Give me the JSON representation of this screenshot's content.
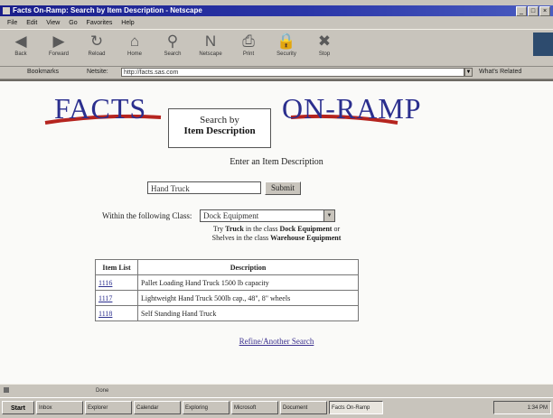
{
  "window": {
    "title": "Facts On-Ramp: Search by Item Description - Netscape"
  },
  "menu": [
    "File",
    "Edit",
    "View",
    "Go",
    "Favorites",
    "Help"
  ],
  "toolbar": [
    {
      "label": "Back",
      "icon": "back-arrow-icon"
    },
    {
      "label": "Forward",
      "icon": "forward-arrow-icon"
    },
    {
      "label": "Reload",
      "icon": "reload-icon"
    },
    {
      "label": "Home",
      "icon": "home-icon"
    },
    {
      "label": "Search",
      "icon": "search-icon"
    },
    {
      "label": "Netscape",
      "icon": "netscape-icon"
    },
    {
      "label": "Print",
      "icon": "print-icon"
    },
    {
      "label": "Security",
      "icon": "lock-icon"
    },
    {
      "label": "Stop",
      "icon": "stop-icon"
    }
  ],
  "address": {
    "bookmarks_label": "Bookmarks",
    "location_label": "Netsite:",
    "url": "http://facts.sas.com",
    "related_label": "What's Related"
  },
  "page": {
    "brand_left": "FACTS",
    "brand_right": "ON-RAMP",
    "box_line1": "Search by",
    "box_line2": "Item Description",
    "instruction": "Enter an Item Description",
    "search_value": "Hand Truck",
    "submit_label": "Submit",
    "class_label": "Within the following Class:",
    "class_value": "Dock Equipment",
    "hint1_pre": "Try",
    "hint1_bold1": "Truck",
    "hint1_mid": "in the class",
    "hint1_bold2": "Dock Equipment",
    "hint1_post": "or",
    "hint2_pre": "Shelves in the class",
    "hint2_bold": "Warehouse Equipment",
    "table_headers": [
      "Item List",
      "Description"
    ],
    "rows": [
      {
        "code": "1116",
        "description": "Pallet Loading Hand Truck 1500 lb capacity"
      },
      {
        "code": "1117",
        "description": "Lightweight Hand Truck 500lb cap., 48\", 8\" wheels"
      },
      {
        "code": "1118",
        "description": "Self Standing Hand Truck"
      }
    ],
    "refine_link": "Refine/Another Search"
  },
  "status": {
    "text": "Done"
  },
  "taskbar": {
    "start": "Start",
    "tasks": [
      "Inbox",
      "Explorer",
      "Calendar",
      "Exploring",
      "Microsoft",
      "Document",
      "Facts On-Ramp"
    ],
    "clock": "1:34 PM"
  }
}
